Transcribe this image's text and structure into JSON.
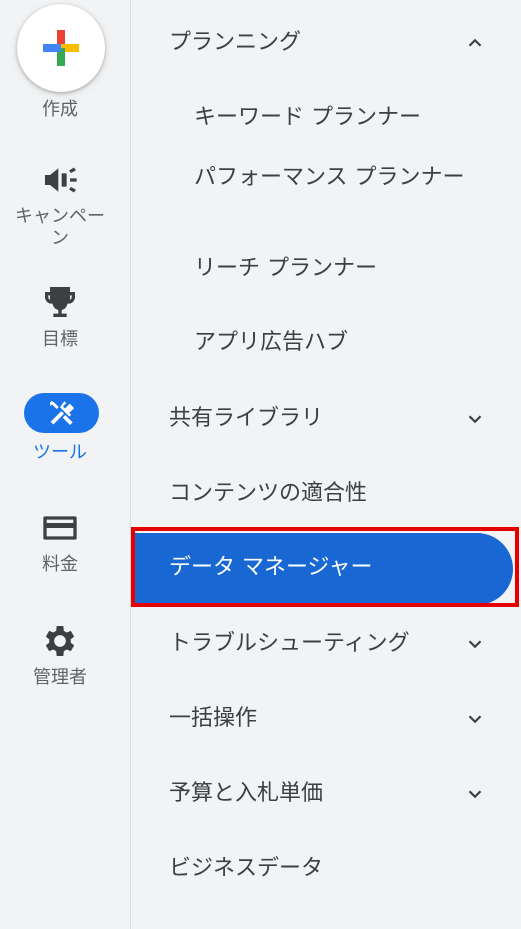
{
  "rail": {
    "create_label": "作成",
    "campaigns_label": "キャンペーン",
    "goals_label": "目標",
    "tools_label": "ツール",
    "billing_label": "料金",
    "admin_label": "管理者",
    "active_color": "#1a73e8"
  },
  "nav": {
    "planning": "プランニング",
    "keyword_planner": "キーワード プランナー",
    "performance_planner": "パフォーマンス プランナー",
    "reach_planner": "リーチ プランナー",
    "app_ads_hub": "アプリ広告ハブ",
    "shared_library": "共有ライブラリ",
    "content_suitability": "コンテンツの適合性",
    "data_manager": "データ マネージャー",
    "troubleshooting": "トラブルシューティング",
    "bulk_actions": "一括操作",
    "budgets_bidding": "予算と入札単価",
    "business_data": "ビジネスデータ"
  },
  "highlight_color": "#e50000"
}
